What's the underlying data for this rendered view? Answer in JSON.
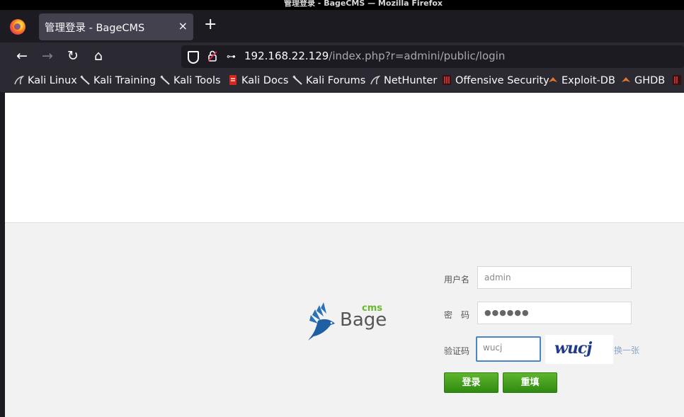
{
  "window": {
    "title": "管理登录 - BageCMS — Mozilla Firefox"
  },
  "tab": {
    "title": "管理登录 - BageCMS",
    "close": "×",
    "new_tab": "+"
  },
  "nav": {
    "back": "←",
    "forward": "→",
    "reload": "↻",
    "home": "⌂"
  },
  "url": {
    "host": "192.168.22.129",
    "path": "/index.php?r=admini/public/login"
  },
  "bookmarks": [
    {
      "label": "Kali Linux",
      "icon": "kali-dragon-icon"
    },
    {
      "label": "Kali Training",
      "icon": "kali-icon"
    },
    {
      "label": "Kali Tools",
      "icon": "kali-icon"
    },
    {
      "label": "Kali Docs",
      "icon": "kali-docs-icon"
    },
    {
      "label": "Kali Forums",
      "icon": "kali-icon"
    },
    {
      "label": "NetHunter",
      "icon": "kali-dragon-icon"
    },
    {
      "label": "Offensive Security",
      "icon": "offsec-icon"
    },
    {
      "label": "Exploit-DB",
      "icon": "exploit-db-icon"
    },
    {
      "label": "GHDB",
      "icon": "ghdb-icon"
    }
  ],
  "logo": {
    "text": "Bage",
    "superscript": "cms"
  },
  "login": {
    "username_label": "用户名",
    "username_value": "admin",
    "password_label": "密　码",
    "password_value": "●●●●●●",
    "captcha_label": "验证码",
    "captcha_value": "wucj",
    "captcha_image_text": "wucj",
    "refresh_captcha": "换一张",
    "login_button": "登录",
    "reset_button": "重填"
  },
  "colors": {
    "accent_green": "#3f9a1a",
    "focus_blue": "#4a86c7",
    "logo_blue": "#2a72b8",
    "logo_green": "#6ab82e"
  }
}
